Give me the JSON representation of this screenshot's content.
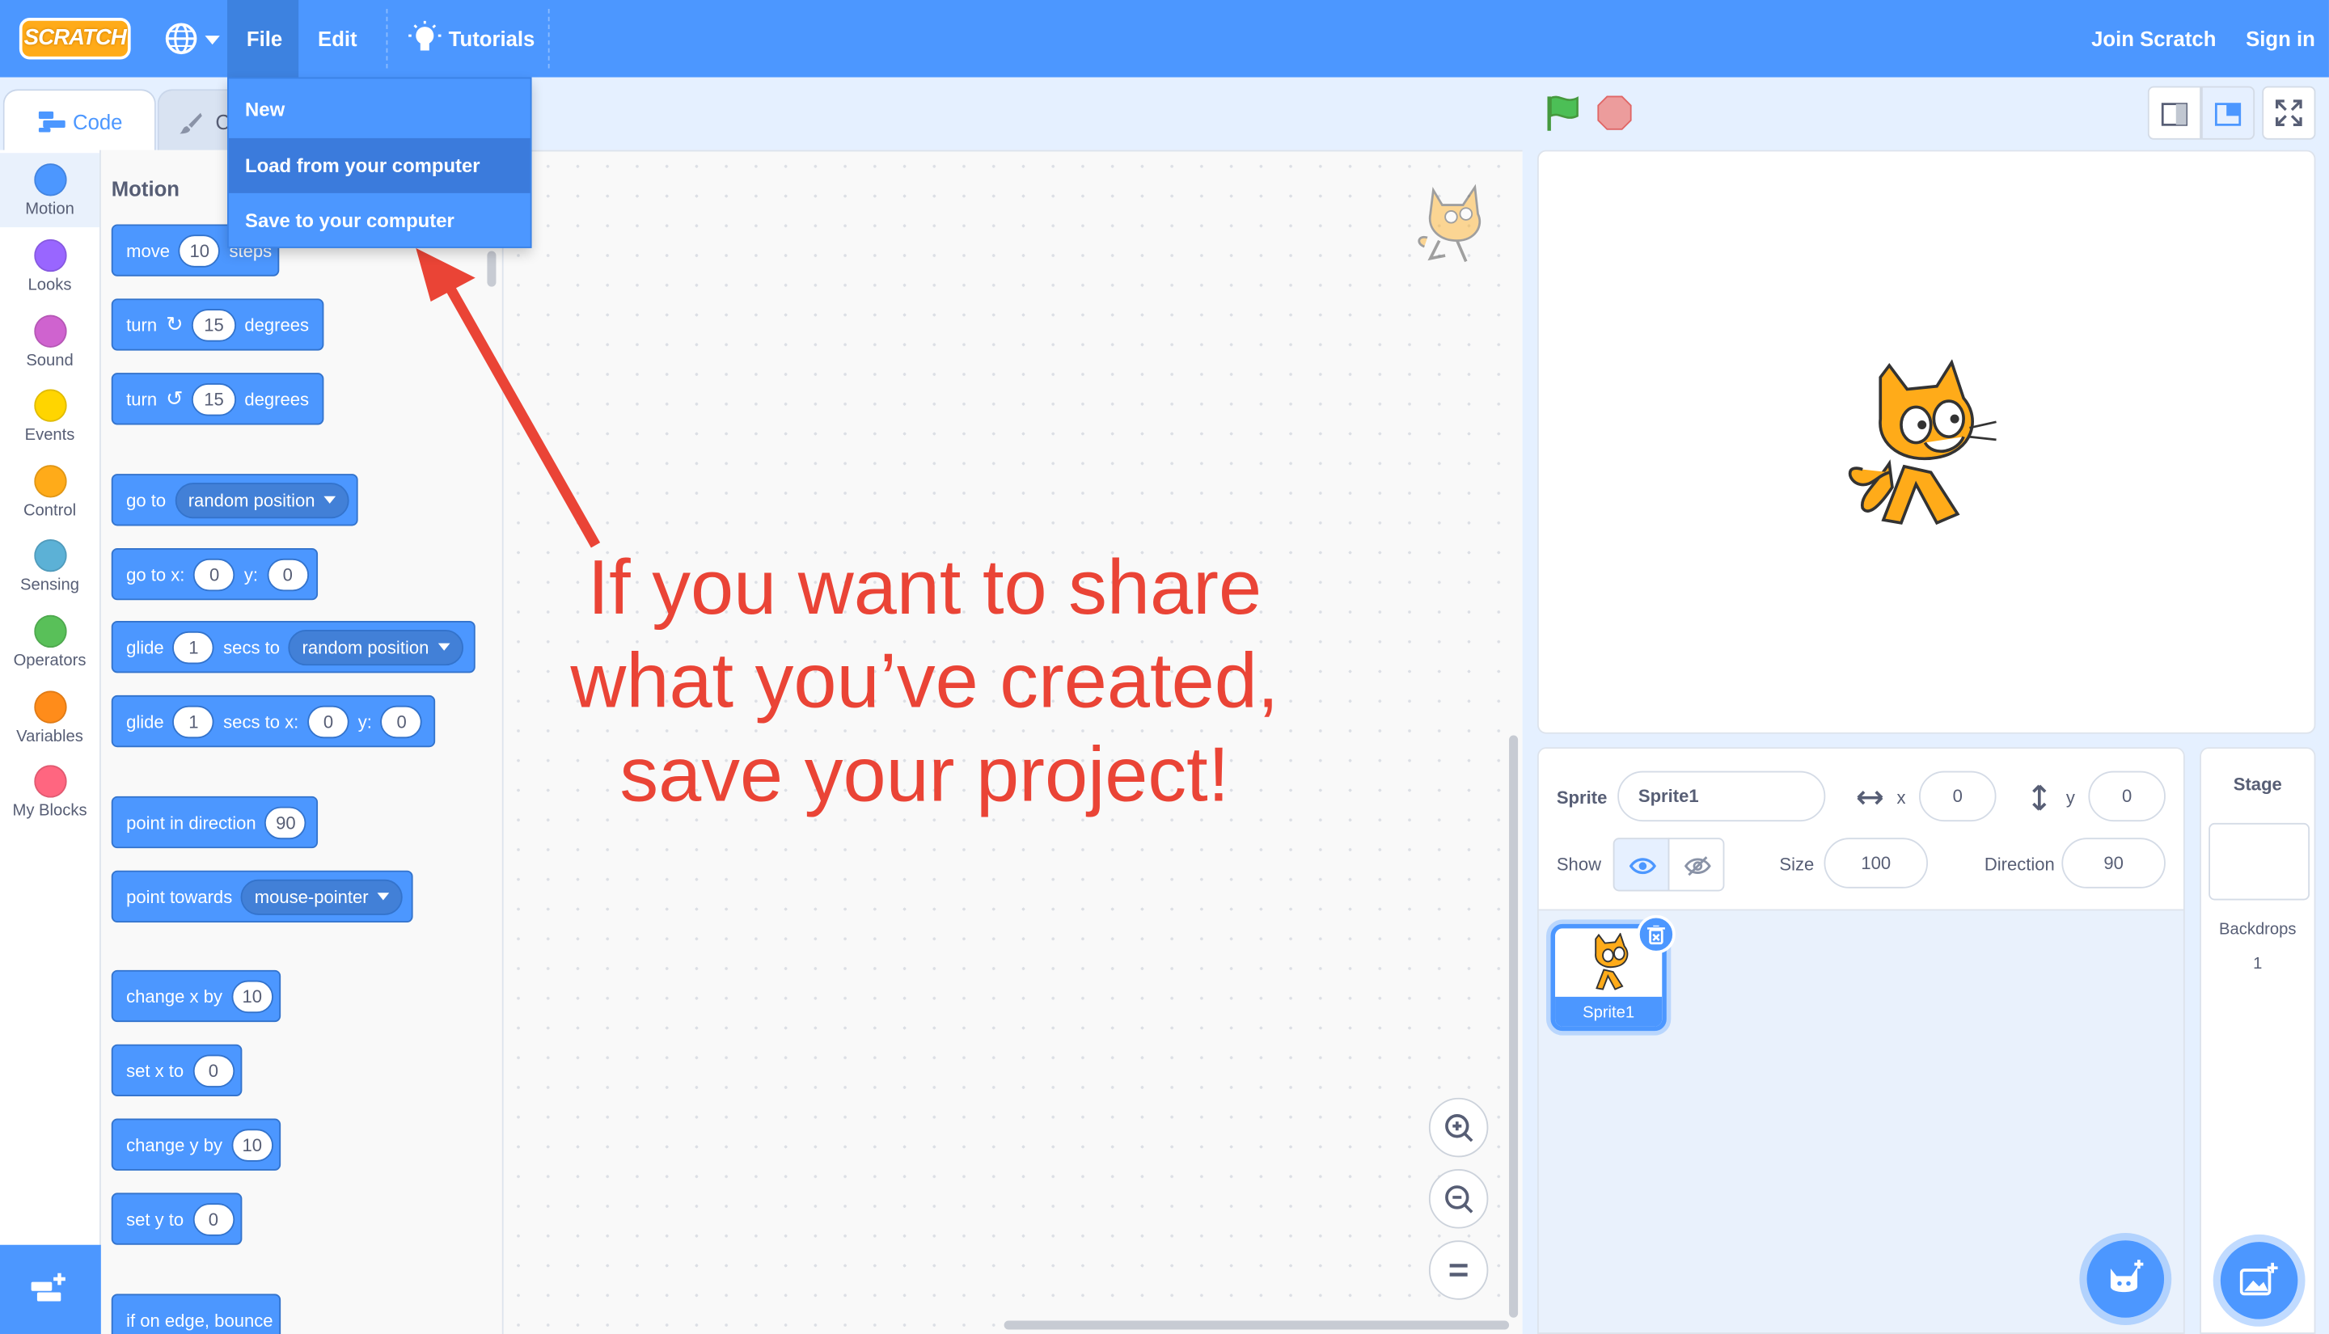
{
  "menubar": {
    "logo": "SCRATCH",
    "file": "File",
    "edit": "Edit",
    "tutorials": "Tutorials",
    "join": "Join Scratch",
    "signin": "Sign in"
  },
  "file_menu": {
    "items": [
      "New",
      "Load from your computer",
      "Save to your computer"
    ]
  },
  "tabs": {
    "code": "Code",
    "costumes_partial": "C"
  },
  "categories": [
    "Motion",
    "Looks",
    "Sound",
    "Events",
    "Control",
    "Sensing",
    "Operators",
    "Variables",
    "My Blocks"
  ],
  "category_colors": [
    "#4c97ff",
    "#9966ff",
    "#cf63cf",
    "#ffd500",
    "#ffab19",
    "#5cb1d6",
    "#59c059",
    "#ff8c1a",
    "#ff6680"
  ],
  "palette": {
    "heading": "Motion",
    "blocks": {
      "move": {
        "a": "move",
        "n": "10",
        "b": "steps"
      },
      "turn_r": {
        "a": "turn",
        "n": "15",
        "b": "degrees"
      },
      "turn_l": {
        "a": "turn",
        "n": "15",
        "b": "degrees"
      },
      "goto": {
        "a": "go to",
        "d": "random position"
      },
      "gotoxy": {
        "a": "go to x:",
        "x": "0",
        "b": "y:",
        "y": "0"
      },
      "glide": {
        "a": "glide",
        "n": "1",
        "b": "secs to",
        "d": "random position"
      },
      "glidexy": {
        "a": "glide",
        "n": "1",
        "b": "secs to x:",
        "x": "0",
        "c": "y:",
        "y": "0"
      },
      "pointdir": {
        "a": "point in direction",
        "n": "90"
      },
      "pointtow": {
        "a": "point towards",
        "d": "mouse-pointer"
      },
      "changex": {
        "a": "change x by",
        "n": "10"
      },
      "setx": {
        "a": "set x to",
        "n": "0"
      },
      "changey": {
        "a": "change y by",
        "n": "10"
      },
      "sety": {
        "a": "set y to",
        "n": "0"
      },
      "bounce": {
        "a": "if on edge, bounce"
      }
    }
  },
  "annotation": {
    "lines": [
      "If you want to share",
      "what you’ve created,",
      "save your project!"
    ]
  },
  "sprite_info": {
    "sprite_label": "Sprite",
    "sprite_name": "Sprite1",
    "x_label": "x",
    "x": "0",
    "y_label": "y",
    "y": "0",
    "show_label": "Show",
    "size_label": "Size",
    "size": "100",
    "direction_label": "Direction",
    "direction": "90"
  },
  "sprite_list": {
    "sprites": [
      "Sprite1"
    ]
  },
  "stage_panel": {
    "title": "Stage",
    "backdrops_label": "Backdrops",
    "backdrops_count": "1"
  },
  "colors": {
    "brand_blue": "#4c97ff",
    "annotation_red": "#ea4436",
    "cat_orange": "#ffab19"
  }
}
